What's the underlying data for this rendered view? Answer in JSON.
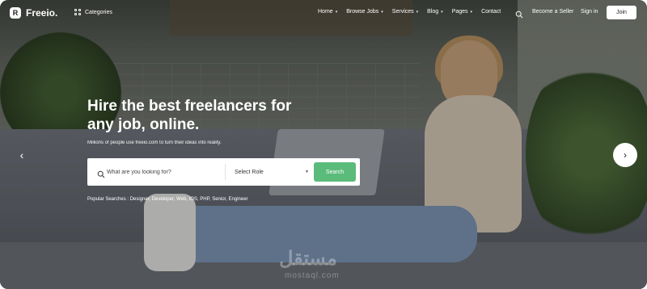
{
  "brand": {
    "logo_letter": "R",
    "name": "Freeio."
  },
  "header": {
    "categories_label": "Categories",
    "nav": [
      {
        "label": "Home",
        "has_dropdown": true
      },
      {
        "label": "Browse Jobs",
        "has_dropdown": true
      },
      {
        "label": "Services",
        "has_dropdown": true
      },
      {
        "label": "Blog",
        "has_dropdown": true
      },
      {
        "label": "Pages",
        "has_dropdown": true
      },
      {
        "label": "Contact",
        "has_dropdown": false
      }
    ],
    "search_icon": "search-icon",
    "become_seller": "Become a Seller",
    "sign_in": "Sign in",
    "join": "Join"
  },
  "hero": {
    "title": "Hire the best freelancers for any job, online.",
    "subtitle": "Millions of people use freeio.com to turn their ideas into reality.",
    "search": {
      "placeholder": "What are you looking for?",
      "select_value": "Select Role",
      "button": "Search"
    },
    "popular_searches": "Popular Searches : Designer, Developer, Web, IOS, PHP, Senior, Engineer"
  },
  "carousel": {
    "prev_icon": "chevron-left-icon",
    "next_icon": "chevron-right-icon"
  },
  "watermark": {
    "text": "مستقل",
    "sub": "mostaql.com"
  },
  "colors": {
    "accent": "#5bbb7b",
    "text_light": "#ffffff",
    "button_bg": "#ffffff"
  }
}
